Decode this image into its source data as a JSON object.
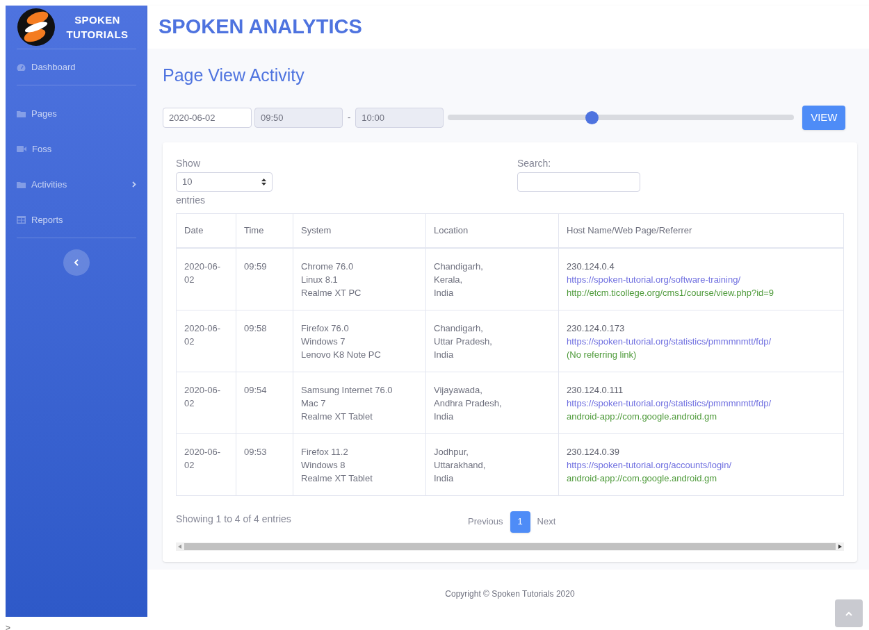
{
  "sidebar": {
    "brand": "SPOKEN TUTORIALS",
    "items": [
      {
        "label": "Dashboard",
        "expandable": false
      },
      {
        "label": "Pages",
        "expandable": false
      },
      {
        "label": "Foss",
        "expandable": false
      },
      {
        "label": "Activities",
        "expandable": true
      },
      {
        "label": "Reports",
        "expandable": false
      }
    ]
  },
  "header": {
    "title": "SPOKEN ANALYTICS"
  },
  "page_title": "Page View Activity",
  "filter": {
    "date": "2020-06-02",
    "start_time": "09:50",
    "separator": "-",
    "end_time": "10:00",
    "slider": {
      "level": 0.415
    },
    "button": "VIEW"
  },
  "table_controls": {
    "show_label": "Show",
    "page_size": "10",
    "entries_label": "entries",
    "search_label": "Search:"
  },
  "table": {
    "columns": [
      "Date",
      "Time",
      "System",
      "Location",
      "Host Name/Web Page/Referrer"
    ],
    "rows": [
      {
        "date": "2020-06-02",
        "time": "09:59",
        "system": [
          "Chrome 76.0",
          "Linux 8.1",
          "Realme XT PC"
        ],
        "location": [
          "Chandigarh,",
          "Kerala,",
          "India"
        ],
        "host": "230.124.0.4",
        "page": "https://spoken-tutorial.org/software-training/",
        "referrer": "http://etcm.ticollege.org/cms1/course/view.php?id=9"
      },
      {
        "date": "2020-06-02",
        "time": "09:58",
        "system": [
          "Firefox 76.0",
          "Windows 7",
          "Lenovo K8 Note PC"
        ],
        "location": [
          "Chandigarh,",
          "Uttar Pradesh,",
          "India"
        ],
        "host": "230.124.0.173",
        "page": "https://spoken-tutorial.org/statistics/pmmmnmtt/fdp/",
        "referrer": "(No referring link)"
      },
      {
        "date": "2020-06-02",
        "time": "09:54",
        "system": [
          "Samsung Internet 76.0",
          "Mac 7",
          "Realme XT Tablet"
        ],
        "location": [
          "Vijayawada,",
          "Andhra Pradesh,",
          "India"
        ],
        "host": "230.124.0.111",
        "page": "https://spoken-tutorial.org/statistics/pmmmnmtt/fdp/",
        "referrer": "android-app://com.google.android.gm"
      },
      {
        "date": "2020-06-02",
        "time": "09:53",
        "system": [
          "Firefox 11.2",
          "Windows 8",
          "Realme XT Tablet"
        ],
        "location": [
          "Jodhpur,",
          "Uttarakhand,",
          "India"
        ],
        "host": "230.124.0.39",
        "page": "https://spoken-tutorial.org/accounts/login/",
        "referrer": "android-app://com.google.android.gm"
      }
    ]
  },
  "table_info": "Showing 1 to 4 of 4 entries",
  "pagination": [
    {
      "label": "Previous",
      "selected": false
    },
    {
      "label": "1",
      "selected": true
    },
    {
      "label": "Next",
      "selected": false
    }
  ],
  "footer": "Copyright © Spoken Tutorials 2020",
  "corner_text": ">"
}
